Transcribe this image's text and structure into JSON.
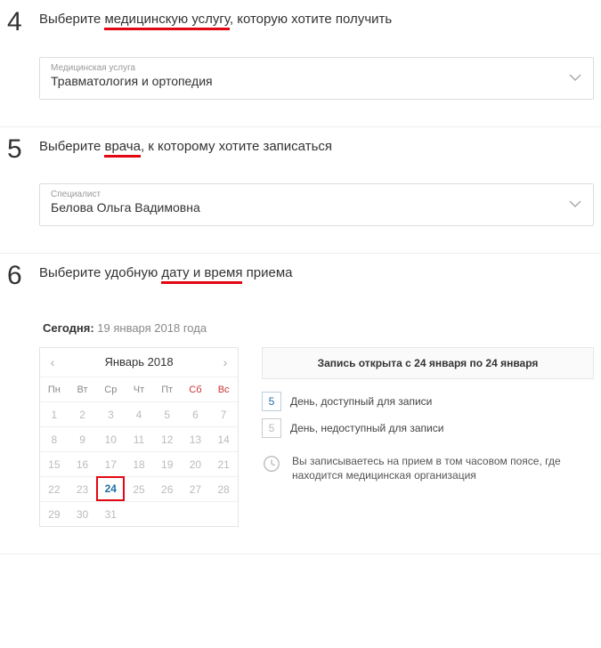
{
  "steps": {
    "s4": {
      "num": "4",
      "title_pre": "Выберите ",
      "title_em": "медицинскую услугу",
      "title_post": ", которую хотите получить",
      "select_label": "Медицинская услуга",
      "select_value": "Травматология и ортопедия"
    },
    "s5": {
      "num": "5",
      "title_pre": "Выберите ",
      "title_em": "врача",
      "title_post": ", к которому хотите записаться",
      "select_label": "Специалист",
      "select_value": "Белова Ольга Вадимовна"
    },
    "s6": {
      "num": "6",
      "title_pre": "Выберите удобную ",
      "title_em": "дату и время",
      "title_post": " приема"
    }
  },
  "today": {
    "label": "Сегодня:",
    "value": "19 января 2018 года"
  },
  "calendar": {
    "month": "Январь 2018",
    "dow": [
      "Пн",
      "Вт",
      "Ср",
      "Чт",
      "Пт",
      "Сб",
      "Вс"
    ],
    "days": [
      "1",
      "2",
      "3",
      "4",
      "5",
      "6",
      "7",
      "8",
      "9",
      "10",
      "11",
      "12",
      "13",
      "14",
      "15",
      "16",
      "17",
      "18",
      "19",
      "20",
      "21",
      "22",
      "23",
      "24",
      "25",
      "26",
      "27",
      "28",
      "29",
      "30",
      "31",
      "",
      "",
      "",
      ""
    ],
    "active_day": "24"
  },
  "info": {
    "banner": "Запись открыта с 24 января по 24 января",
    "legend_avail_num": "5",
    "legend_avail_text": "День, доступный для записи",
    "legend_unavail_num": "5",
    "legend_unavail_text": "День, недоступный для записи",
    "tz_text": "Вы записываетесь на прием в том часовом поясе, где находится медицинская организация"
  }
}
